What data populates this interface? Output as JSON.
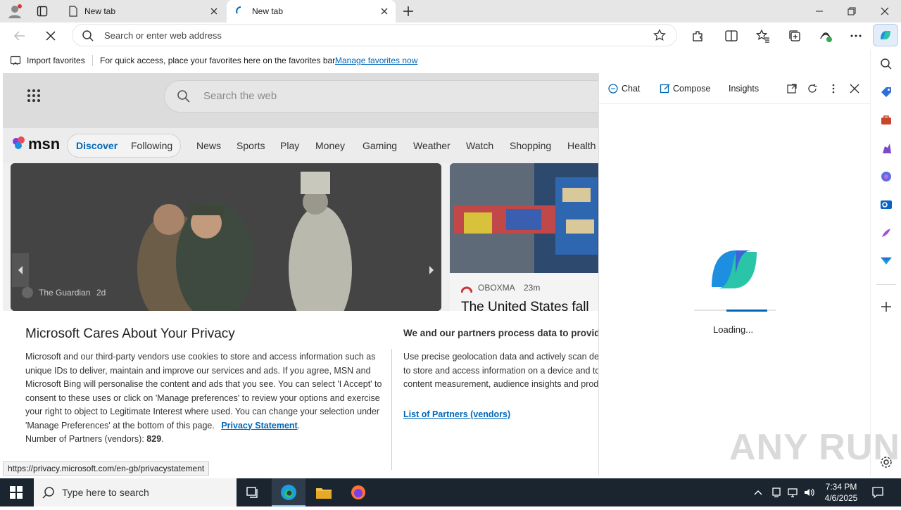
{
  "browser": {
    "tabs": [
      {
        "label": "New tab",
        "active": false
      },
      {
        "label": "New tab",
        "active": true
      }
    ],
    "address_placeholder": "Search or enter web address"
  },
  "favorites_bar": {
    "import_label": "Import favorites",
    "hint": "For quick access, place your favorites here on the favorites bar.",
    "manage_link": "Manage favorites now"
  },
  "msn": {
    "search_placeholder": "Search the web",
    "logo": "msn",
    "nav": [
      "Discover",
      "Following",
      "News",
      "Sports",
      "Play",
      "Money",
      "Gaming",
      "Weather",
      "Watch",
      "Shopping",
      "Health"
    ],
    "card_left": {
      "source": "The Guardian",
      "age": "2d"
    },
    "card_right": {
      "source": "OBOXMA",
      "age": "23m",
      "headline": "The United States fall"
    }
  },
  "privacy": {
    "title": "Microsoft Cares About Your Privacy",
    "body": "Microsoft and our third-party vendors use cookies to store and access information such as unique IDs to deliver, maintain and improve our services and ads. If you agree, MSN and Microsoft Bing will personalise the content and ads that you see. You can select 'I Accept' to consent to these uses or click on 'Manage preferences' to review your options and exercise your right to object to Legitimate Interest where used.  You can change your selection under 'Manage Preferences' at the bottom of this page.",
    "privacy_link": "Privacy Statement",
    "partners_count_label": "Number of Partners (vendors): ",
    "partners_count": "829",
    "right_title": "We and our partners process data to provide:",
    "right_body": "Use precise geolocation data and actively scan device characteristics for identification. This is done to store and access information on a device and to provide personalised ads and content, ad and content measurement, audience insights and product development.",
    "partners_link": "List of Partners (vendors)"
  },
  "status_url": "https://privacy.microsoft.com/en-gb/privacystatement",
  "copilot": {
    "tabs": [
      "Chat",
      "Compose",
      "Insights"
    ],
    "loading": "Loading..."
  },
  "taskbar": {
    "search_placeholder": "Type here to search",
    "time": "7:34 PM",
    "date": "4/6/2025"
  },
  "watermark": "ANY RUN",
  "colors": {
    "accent": "#0067b8",
    "taskbar": "#1b2530"
  }
}
